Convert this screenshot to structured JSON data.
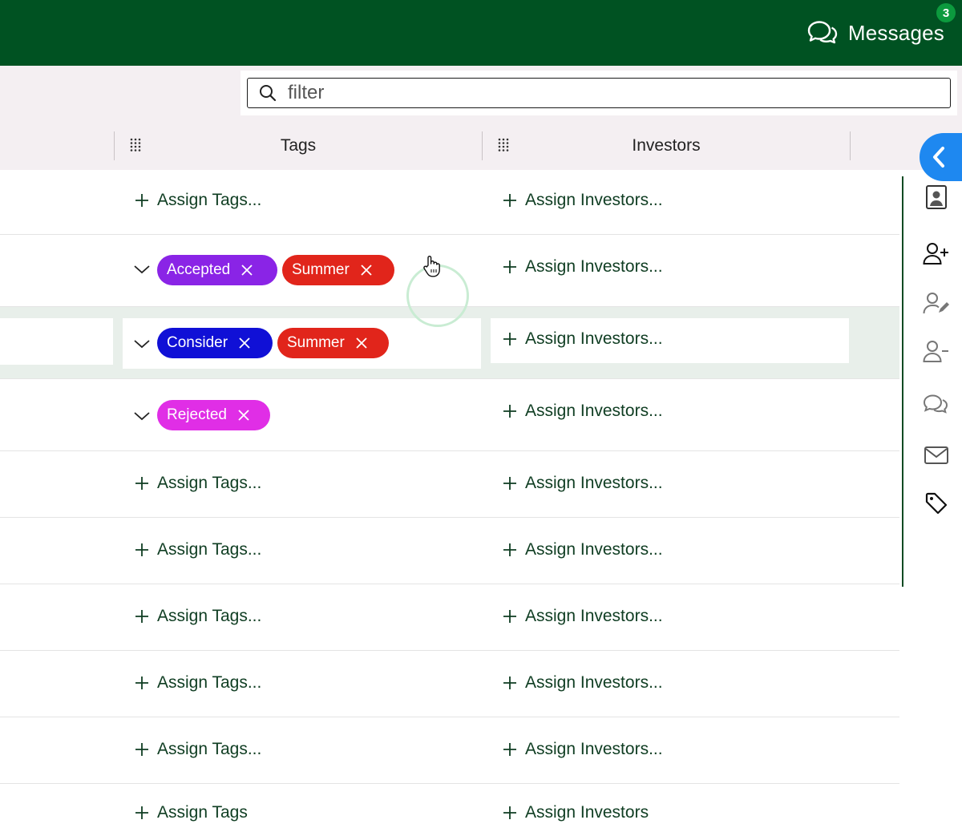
{
  "header": {
    "messages_label": "Messages",
    "messages_count": "3",
    "icon": "chat-bubbles-icon"
  },
  "filter": {
    "placeholder": "filter"
  },
  "columns": [
    {
      "label": "Tags"
    },
    {
      "label": "Investors"
    }
  ],
  "rows": [
    {
      "assign_tags": "Assign Tags...",
      "assign_investors": "Assign Investors..."
    },
    {
      "tags": [
        {
          "label": "Accepted",
          "color": "#8a24e6"
        },
        {
          "label": "Summer",
          "color": "#e1251b"
        }
      ],
      "assign_investors": "Assign Investors..."
    },
    {
      "tags": [
        {
          "label": "Consider",
          "color": "#1010d6"
        },
        {
          "label": "Summer",
          "color": "#e1251b"
        }
      ],
      "assign_investors": "Assign Investors..."
    },
    {
      "tags": [
        {
          "label": "Rejected",
          "color": "#e02ee6"
        }
      ],
      "assign_investors": "Assign Investors..."
    },
    {
      "assign_tags": "Assign Tags...",
      "assign_investors": "Assign Investors..."
    },
    {
      "assign_tags": "Assign Tags...",
      "assign_investors": "Assign Investors..."
    },
    {
      "assign_tags": "Assign Tags...",
      "assign_investors": "Assign Investors..."
    },
    {
      "assign_tags": "Assign Tags...",
      "assign_investors": "Assign Investors..."
    },
    {
      "assign_tags": "Assign Tags...",
      "assign_investors": "Assign Investors..."
    },
    {
      "assign_tags": "Assign Tags",
      "assign_investors": "Assign Investors"
    }
  ],
  "rail": {
    "collapse_icon": "chevron-left-icon",
    "icons": [
      "contact-card-icon",
      "add-user-icon",
      "edit-user-icon",
      "remove-user-icon",
      "chat-icon",
      "mail-icon",
      "tag-icon"
    ]
  },
  "colors": {
    "header": "#005222",
    "accent": "#1e88f0",
    "text_green": "#0f3d22"
  }
}
